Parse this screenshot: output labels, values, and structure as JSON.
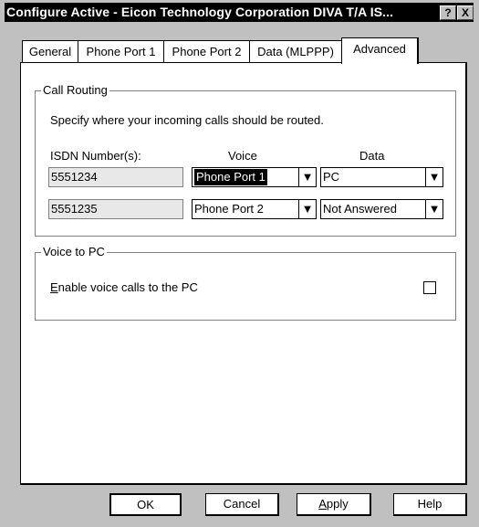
{
  "window": {
    "title": "Configure Active - Eicon Technology Corporation DIVA T/A IS..."
  },
  "titlebar": {
    "help_label": "?",
    "close_label": "X"
  },
  "tabs": [
    {
      "label": "General"
    },
    {
      "label": "Phone Port 1"
    },
    {
      "label": "Phone Port 2"
    },
    {
      "label": "Data (MLPPP)"
    },
    {
      "label": "Advanced",
      "active": true
    }
  ],
  "call_routing": {
    "group_label": "Call Routing",
    "instruction": "Specify where your incoming calls should be routed.",
    "col_isdn": "ISDN Number(s):",
    "col_voice": "Voice",
    "col_data": "Data",
    "rows": [
      {
        "isdn": "5551234",
        "voice": "Phone Port 1",
        "data": "PC"
      },
      {
        "isdn": "5551235",
        "voice": "Phone Port 2",
        "data": "Not Answered"
      }
    ]
  },
  "voice_to_pc": {
    "group_label": "Voice to PC",
    "enable_label_first": "E",
    "enable_label_rest": "nable voice calls to the PC",
    "enabled": false
  },
  "buttons": {
    "ok": "OK",
    "cancel": "Cancel",
    "apply_first": "A",
    "apply_rest": "pply",
    "help": "Help"
  }
}
